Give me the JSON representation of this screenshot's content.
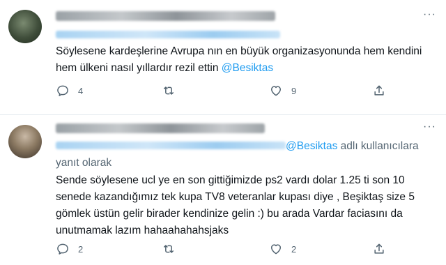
{
  "tweets": [
    {
      "text": "Söylesene kardeşlerine Avrupa nın en büyük organizasyonunda hem kendini hem ülkeni nasıl yıllardır rezil ettin ",
      "mention": "@Besiktas",
      "actions": {
        "reply_count": "4",
        "retweet_count": "",
        "like_count": "9"
      }
    },
    {
      "reply_to_mention": "@Besiktas",
      "reply_to_suffix": " adlı kullanıcılara yanıt olarak",
      "text": "Sende söylesene ucl ye en son gittiğimizde ps2 vardı dolar 1.25 ti son 10 senede kazandığımız tek kupa TV8 veteranlar kupası diye , Beşiktaş size 5 gömlek üstün gelir birader kendinize gelin :) bu arada Vardar faciasını da unutmamak lazım hahaahahahsjaks",
      "actions": {
        "reply_count": "2",
        "retweet_count": "",
        "like_count": "2"
      }
    }
  ],
  "icons": {
    "reply": "reply-icon",
    "retweet": "retweet-icon",
    "like": "heart-icon",
    "share": "share-icon",
    "more": "more-icon"
  },
  "colors": {
    "accent": "#1d9bf0",
    "muted": "#536471",
    "text": "#0f1419"
  }
}
